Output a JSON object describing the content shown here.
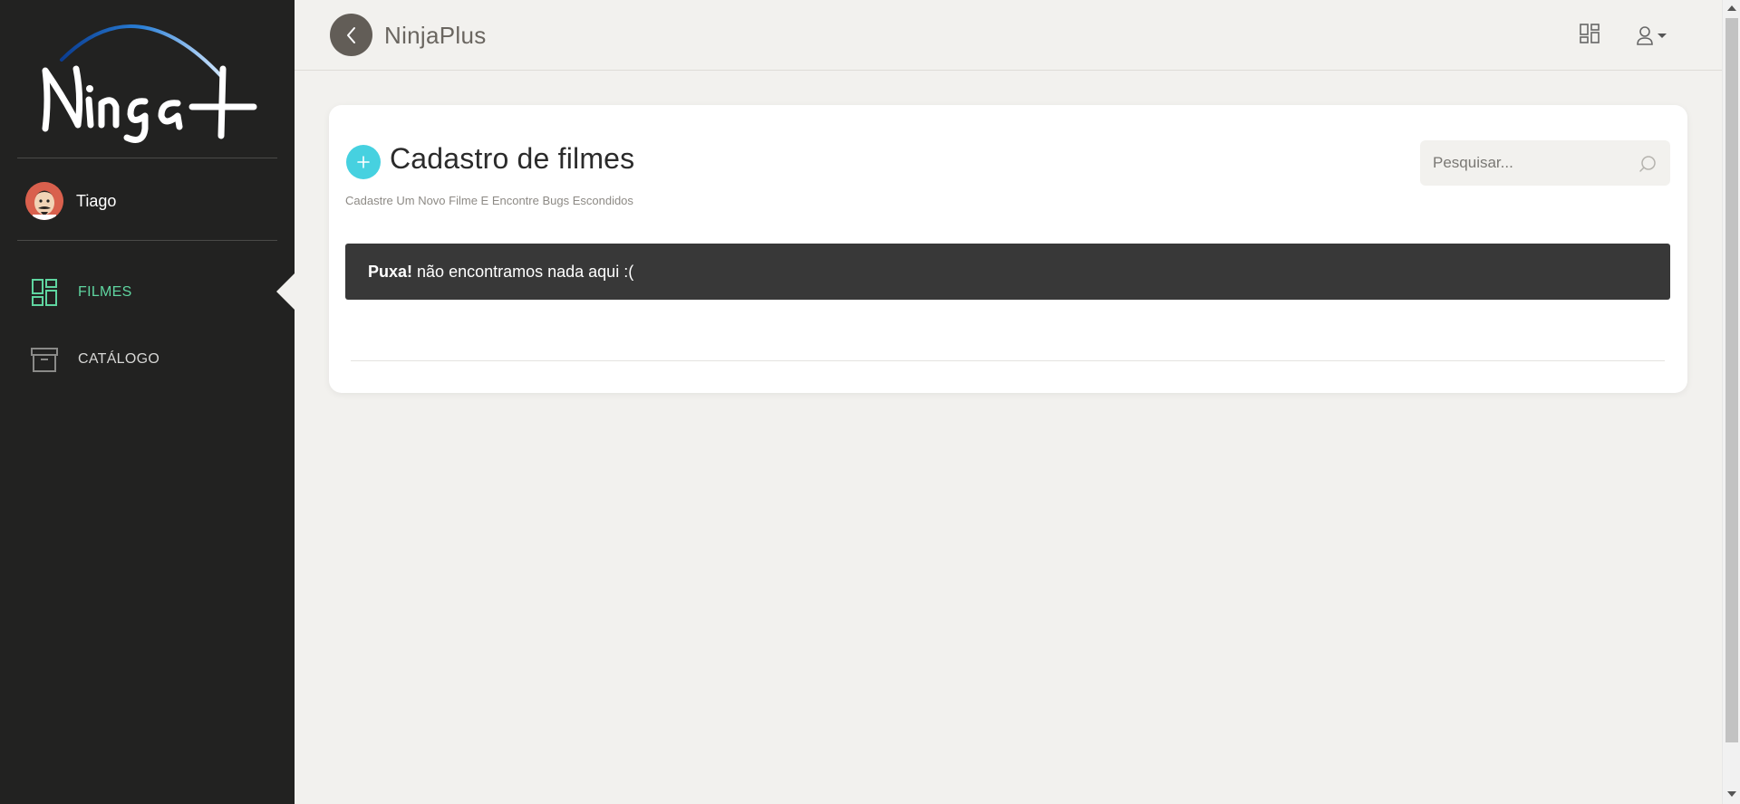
{
  "sidebar": {
    "logo_text": "Ninja+",
    "user_name": "Tiago",
    "items": [
      {
        "label": "FILMES",
        "icon": "dashboard-grid-icon",
        "active": true
      },
      {
        "label": "CATÁLOGO",
        "icon": "archive-box-icon",
        "active": false
      }
    ]
  },
  "topbar": {
    "title": "NinjaPlus",
    "back_icon": "chevron-left-icon",
    "grid_icon": "dashboard-grid-icon",
    "user_icon": "user-icon"
  },
  "main": {
    "title": "Cadastro de filmes",
    "subtitle": "Cadastre Um Novo Filme E Encontre Bugs Escondidos",
    "search_placeholder": "Pesquisar...",
    "alert": {
      "strong": "Puxa!",
      "message": "não encontramos nada aqui :("
    }
  },
  "colors": {
    "sidebar_bg": "#222221",
    "accent_green": "#5fd5a0",
    "accent_cyan": "#46d1e0",
    "alert_bg": "#383838",
    "page_bg": "#f2f1ee"
  }
}
